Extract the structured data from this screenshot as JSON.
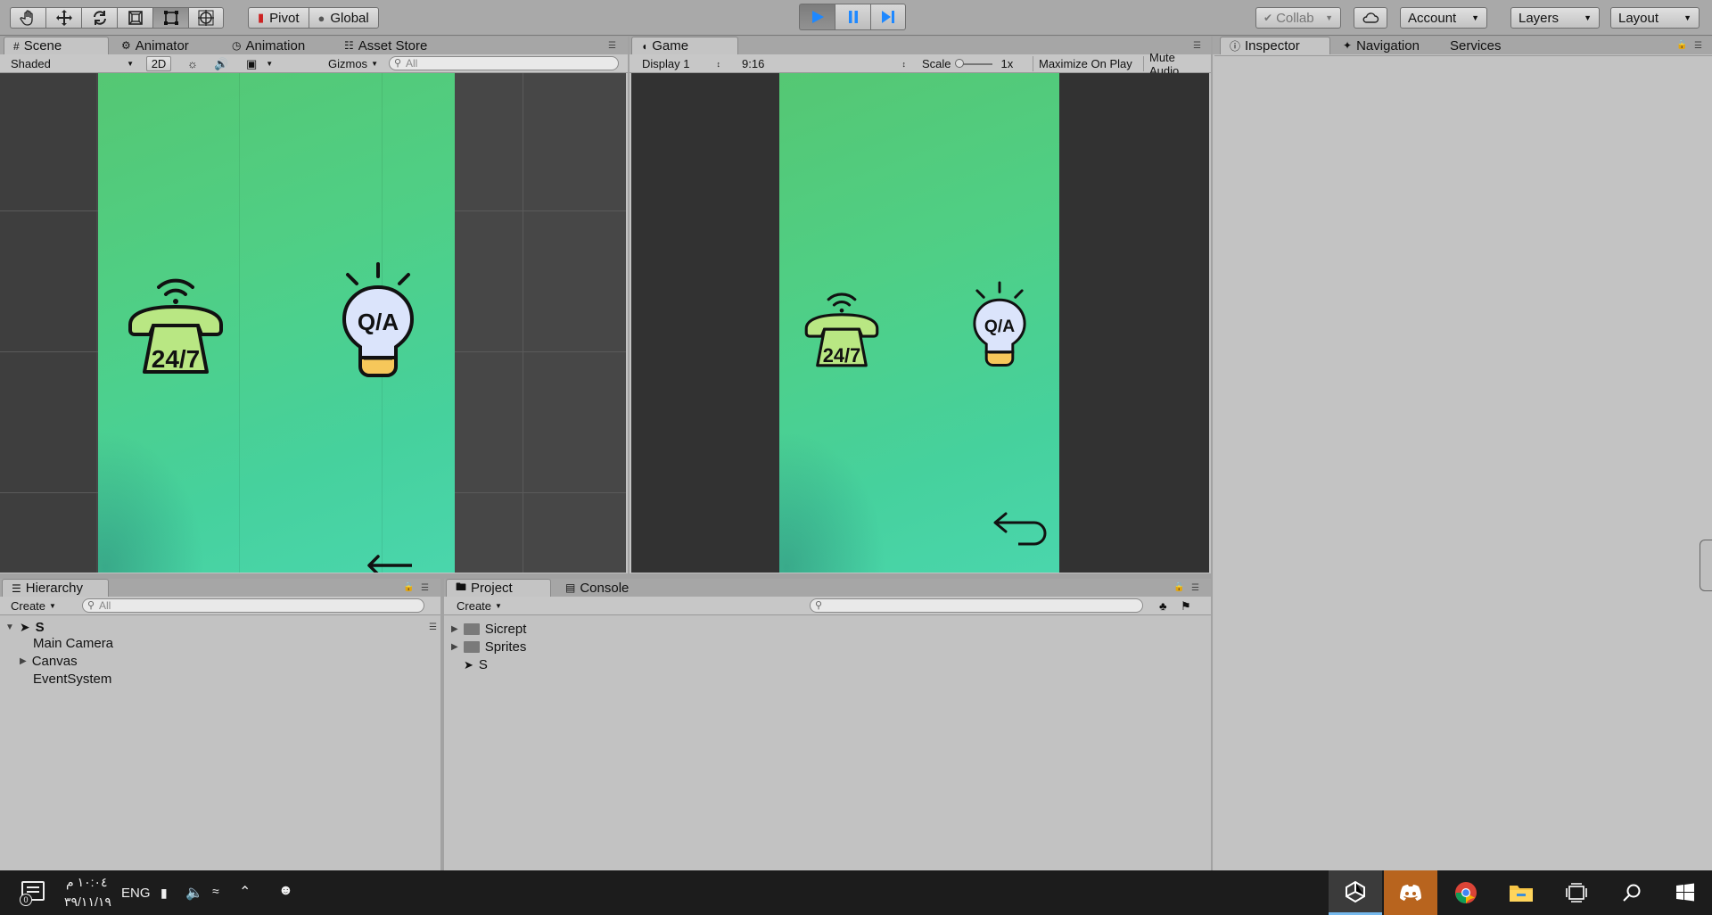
{
  "toolbar": {
    "tools": [
      {
        "name": "hand-tool-icon"
      },
      {
        "name": "move-tool-icon"
      },
      {
        "name": "rotate-tool-icon"
      },
      {
        "name": "scale-tool-icon"
      },
      {
        "name": "rect-tool-icon"
      },
      {
        "name": "transform-tool-icon"
      }
    ],
    "pivot_label": "Pivot",
    "global_label": "Global",
    "collab_label": "Collab",
    "account_label": "Account",
    "layers_label": "Layers",
    "layout_label": "Layout"
  },
  "scene": {
    "tabs": [
      "Scene",
      "Animator",
      "Animation",
      "Asset Store"
    ],
    "shading": "Shaded",
    "mode_2d": "2D",
    "gizmos": "Gizmos",
    "search_placeholder": "All"
  },
  "game": {
    "tab": "Game",
    "display": "Display 1",
    "aspect": "9:16",
    "scale_label": "Scale",
    "scale_value": "1x",
    "maximize": "Maximize On Play",
    "mute": "Mute Audio"
  },
  "inspector": {
    "tabs": [
      "Inspector",
      "Navigation",
      "Services"
    ]
  },
  "graphics": {
    "phone_text": "24/7",
    "bulb_text": "Q/A"
  },
  "hierarchy": {
    "tab": "Hierarchy",
    "create": "Create",
    "search_placeholder": "All",
    "scene_name": "S",
    "items": [
      "Main Camera",
      "Canvas",
      "EventSystem"
    ]
  },
  "project": {
    "tabs": [
      "Project",
      "Console"
    ],
    "create": "Create",
    "items": [
      "Sicrept",
      "Sprites",
      "S"
    ]
  },
  "taskbar": {
    "time": "١٠:٠٤ م",
    "date": "٣٩/١١/١٩",
    "language": "ENG"
  },
  "colors": {
    "play_blue": "#1e88ff",
    "mint_green": "#4fcf86"
  }
}
